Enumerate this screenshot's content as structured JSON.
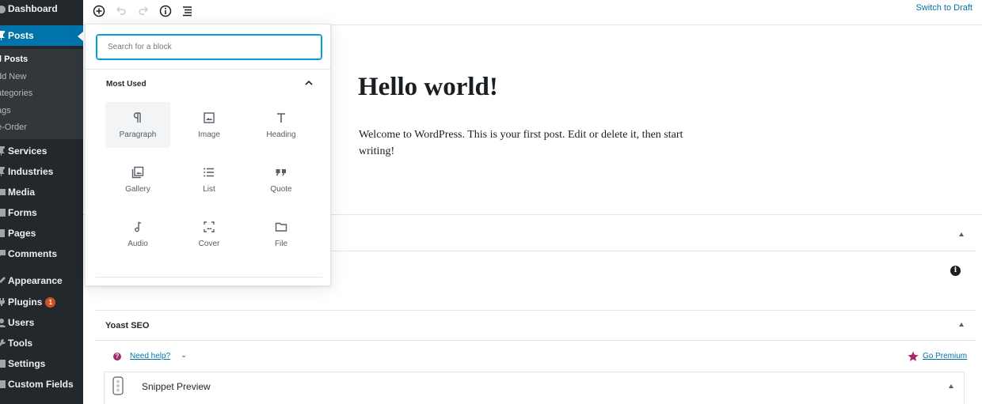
{
  "sidebar": {
    "items": [
      {
        "label": "Dashboard",
        "icon": "dashboard-icon"
      },
      {
        "label": "Posts",
        "icon": "pin-icon",
        "active": true
      },
      {
        "label": "Services",
        "icon": "pin-icon"
      },
      {
        "label": "Industries",
        "icon": "pin-icon"
      },
      {
        "label": "Media",
        "icon": "media-icon"
      },
      {
        "label": "Forms",
        "icon": "forms-icon"
      },
      {
        "label": "Pages",
        "icon": "page-icon"
      },
      {
        "label": "Comments",
        "icon": "comment-icon"
      },
      {
        "label": "Appearance",
        "icon": "brush-icon"
      },
      {
        "label": "Plugins",
        "icon": "plugin-icon",
        "badge": "1"
      },
      {
        "label": "Users",
        "icon": "user-icon"
      },
      {
        "label": "Tools",
        "icon": "wrench-icon"
      },
      {
        "label": "Settings",
        "icon": "settings-icon"
      },
      {
        "label": "Custom Fields",
        "icon": "fields-icon"
      }
    ],
    "posts_submenu": [
      "ll Posts",
      "dd New",
      "ategories",
      "ags",
      "e-Order"
    ]
  },
  "toolbar": {
    "switch_to_draft": "Switch to Draft",
    "icons": [
      "add-block-icon",
      "undo-icon",
      "redo-icon",
      "info-icon",
      "outline-icon"
    ]
  },
  "post": {
    "title": "Hello world!",
    "body": "Welcome to WordPress. This is your first post. Edit or delete it, then start writing!"
  },
  "inserter": {
    "search_placeholder": "Search for a block",
    "section_label": "Most Used",
    "blocks": [
      {
        "label": "Paragraph",
        "icon": "paragraph-icon"
      },
      {
        "label": "Image",
        "icon": "image-icon"
      },
      {
        "label": "Heading",
        "icon": "heading-icon"
      },
      {
        "label": "Gallery",
        "icon": "gallery-icon"
      },
      {
        "label": "List",
        "icon": "list-icon"
      },
      {
        "label": "Quote",
        "icon": "quote-icon"
      },
      {
        "label": "Audio",
        "icon": "audio-icon"
      },
      {
        "label": "Cover",
        "icon": "cover-icon"
      },
      {
        "label": "File",
        "icon": "folder-icon"
      }
    ]
  },
  "yoast": {
    "title": "Yoast SEO",
    "need_help": "Need help?",
    "go_premium": "Go Premium",
    "snippet_preview": "Snippet Preview"
  },
  "colors": {
    "admin_sidebar": "#23282d",
    "admin_active": "#0073aa",
    "link": "#0073aa",
    "focus": "#00a0d2",
    "yoast": "#a4286a",
    "plugin_badge": "#d54e21"
  }
}
